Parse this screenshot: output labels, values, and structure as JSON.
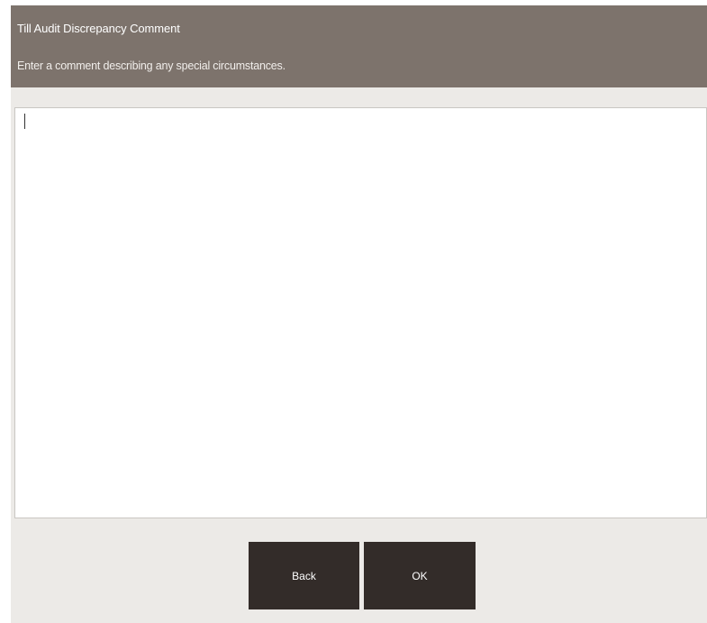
{
  "dialog": {
    "title": "Till Audit Discrepancy Comment",
    "subtitle": "Enter a comment describing any special circumstances."
  },
  "comment": {
    "value": "",
    "placeholder": ""
  },
  "buttons": {
    "back_label": "Back",
    "ok_label": "OK"
  },
  "colors": {
    "header_bg": "#7d736c",
    "dialog_bg": "#eceae7",
    "button_bg": "#332c29",
    "text_on_dark": "#ffffff"
  }
}
